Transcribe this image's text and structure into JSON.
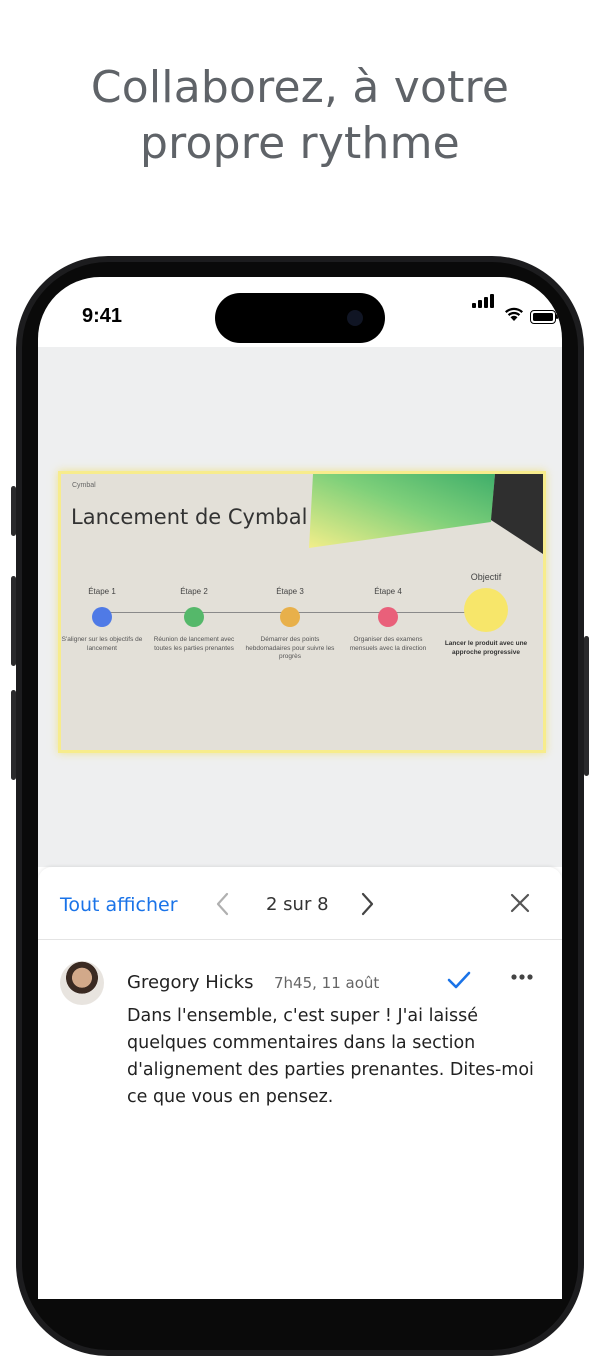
{
  "headline": {
    "line1": "Collaborez, à votre",
    "line2": "propre rythme"
  },
  "status_bar": {
    "time": "9:41"
  },
  "slide": {
    "brand": "Cymbal",
    "title": "Lancement de Cymbal",
    "stages": [
      {
        "label": "Étape 1",
        "color": "#4f7ae6",
        "desc": "S'aligner sur les objectifs de lancement"
      },
      {
        "label": "Étape 2",
        "color": "#55b86a",
        "desc": "Réunion de lancement avec toutes les parties prenantes"
      },
      {
        "label": "Étape 3",
        "color": "#e8b04a",
        "desc": "Démarrer des points hebdomadaires pour suivre les progrès"
      },
      {
        "label": "Étape 4",
        "color": "#e9607a",
        "desc": "Organiser des examens mensuels avec la direction"
      },
      {
        "label": "Objectif",
        "color": "#f7e66a",
        "desc": "Lancer le produit avec une approche progressive"
      }
    ]
  },
  "comment_panel": {
    "show_all": "Tout afficher",
    "pager": "2 sur 8",
    "author": "Gregory Hicks",
    "time": "7h45, 11 août",
    "text": "Dans l'ensemble, c'est super ! J'ai laissé quelques commentaires dans la section d'alignement des parties prenantes. Dites-moi ce que vous en pensez."
  },
  "colors": {
    "accent": "#1a73e8",
    "headline": "#5f6368"
  },
  "icons": [
    "chevron-left-icon",
    "chevron-right-icon",
    "close-icon",
    "check-icon",
    "more-icon",
    "signal-icon",
    "wifi-icon",
    "battery-icon"
  ]
}
